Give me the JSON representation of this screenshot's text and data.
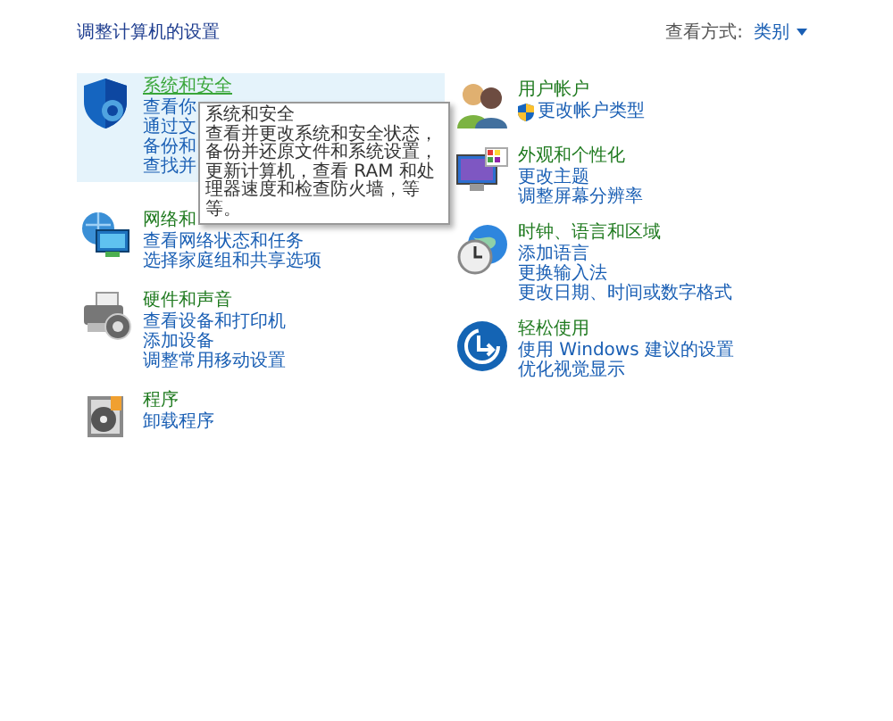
{
  "header": {
    "title": "调整计算机的设置",
    "view_by_label": "查看方式:",
    "view_by_value": "类别"
  },
  "columns": [
    {
      "categories": [
        {
          "title": "系统和安全",
          "highlighted": true,
          "links": [
            {
              "text": "查看你"
            },
            {
              "text": "通过文"
            },
            {
              "text": "备份和"
            },
            {
              "text": "查找并"
            }
          ]
        },
        {
          "title": "网络和",
          "highlighted": false,
          "links": [
            {
              "text": "查看网络状态和任务"
            },
            {
              "text": "选择家庭组和共享选项"
            }
          ]
        },
        {
          "title": "硬件和声音",
          "highlighted": false,
          "links": [
            {
              "text": "查看设备和打印机"
            },
            {
              "text": "添加设备"
            },
            {
              "text": "调整常用移动设置"
            }
          ]
        },
        {
          "title": "程序",
          "highlighted": false,
          "links": [
            {
              "text": "卸载程序"
            }
          ]
        }
      ]
    },
    {
      "categories": [
        {
          "title": "用户帐户",
          "highlighted": false,
          "links": [
            {
              "text": "更改帐户类型",
              "shield": true
            }
          ]
        },
        {
          "title": "外观和个性化",
          "highlighted": false,
          "links": [
            {
              "text": "更改主题"
            },
            {
              "text": "调整屏幕分辨率"
            }
          ]
        },
        {
          "title": "时钟、语言和区域",
          "highlighted": false,
          "links": [
            {
              "text": "添加语言"
            },
            {
              "text": "更换输入法"
            },
            {
              "text": "更改日期、时间或数字格式"
            }
          ]
        },
        {
          "title": "轻松使用",
          "highlighted": false,
          "links": [
            {
              "text": "使用 Windows 建议的设置"
            },
            {
              "text": "优化视觉显示"
            }
          ]
        }
      ]
    }
  ],
  "tooltip": {
    "title": "系统和安全",
    "text": "查看并更改系统和安全状态，备份并还原文件和系统设置，更新计算机，查看 RAM 和处理器速度和检查防火墙，等等。"
  }
}
